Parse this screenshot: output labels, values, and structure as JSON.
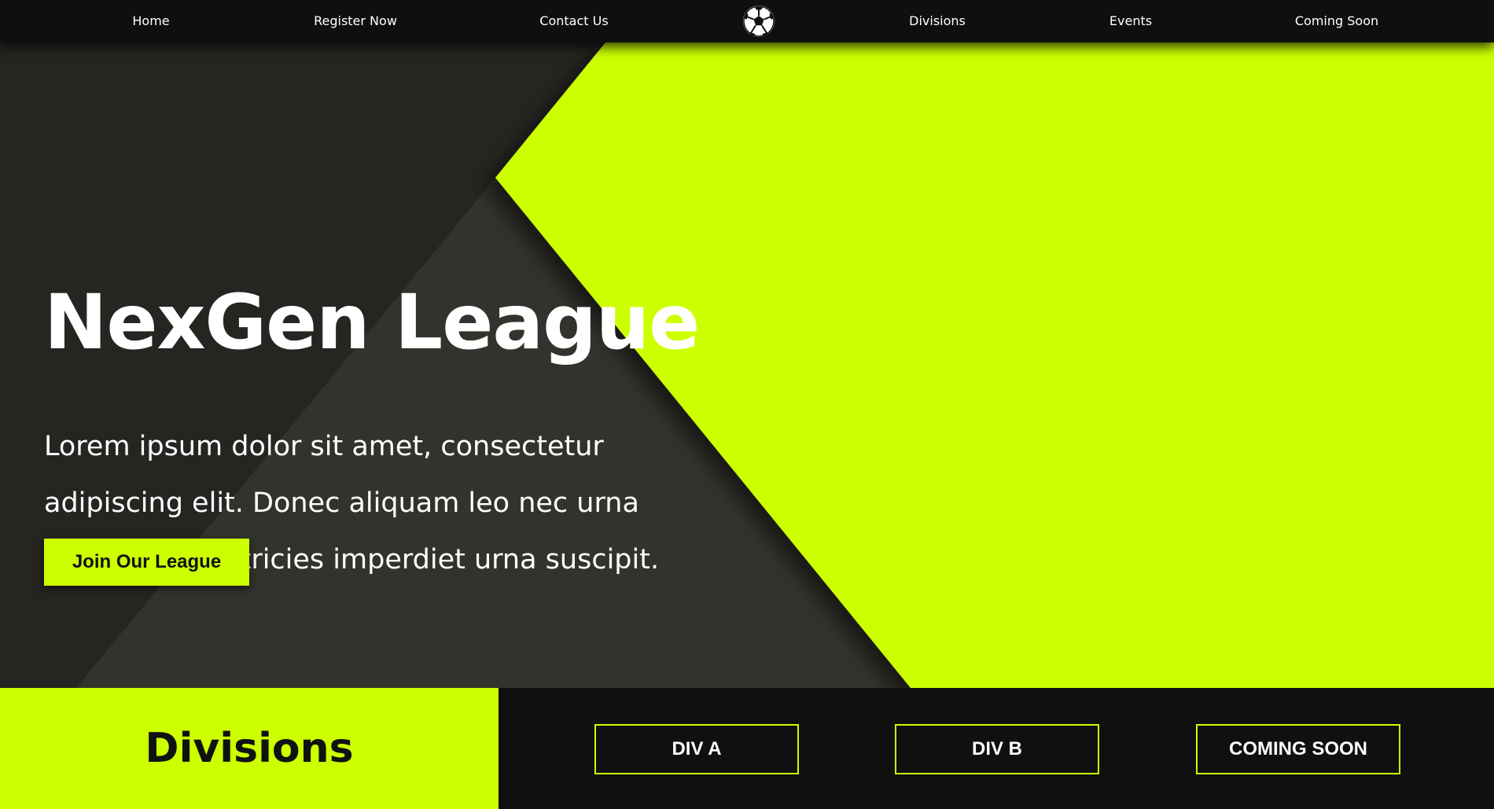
{
  "nav": {
    "items": [
      {
        "label": "Home"
      },
      {
        "label": "Register Now"
      },
      {
        "label": "Contact Us"
      },
      {
        "label": "Divisions"
      },
      {
        "label": "Events"
      },
      {
        "label": "Coming Soon"
      }
    ],
    "logo_icon": "soccer-ball-icon"
  },
  "hero": {
    "title": "NexGen League",
    "description_lines": [
      "Lorem ipsum dolor sit amet, consectetur",
      "adipiscing elit. Donec aliquam leo nec urna",
      "fermentum, ultricies imperdiet urna suscipit."
    ],
    "cta_label": "Join Our League"
  },
  "divisions": {
    "heading": "Divisions",
    "buttons": [
      {
        "label": "DIV A"
      },
      {
        "label": "DIV B"
      },
      {
        "label": "COMING SOON"
      }
    ]
  },
  "colors": {
    "accent": "#ccff00",
    "dark": "#0f0f0f",
    "hero_dark": "#252522",
    "hero_mid": "#33332d"
  }
}
